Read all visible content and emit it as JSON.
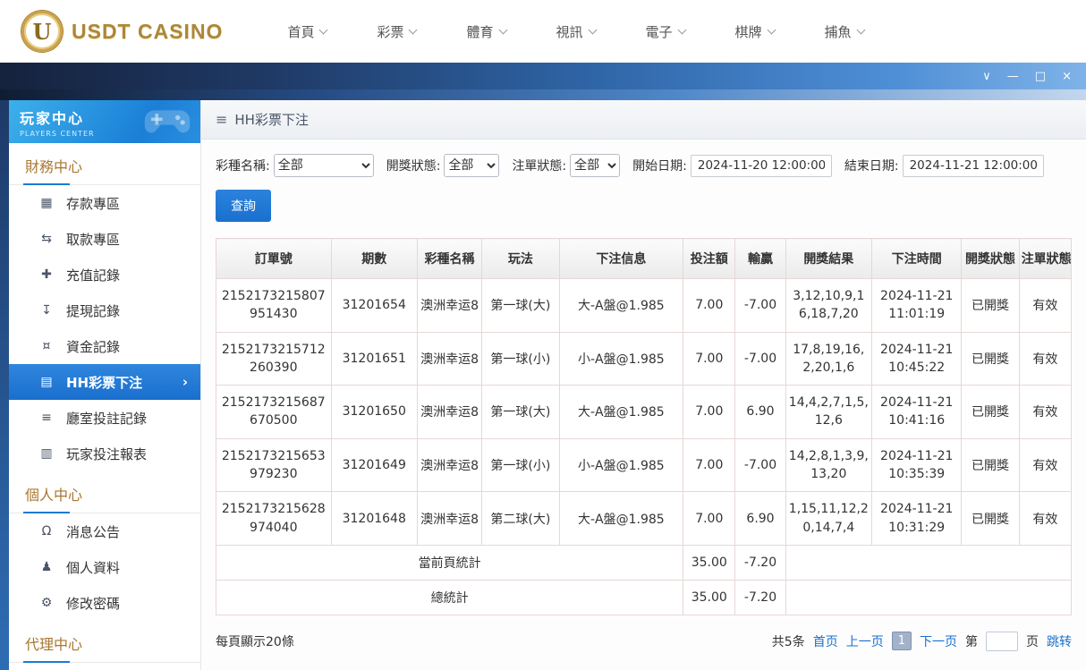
{
  "top_nav": {
    "brand": "USDT CASINO",
    "logo_letter": "U",
    "items": [
      {
        "label": "首頁"
      },
      {
        "label": "彩票"
      },
      {
        "label": "體育"
      },
      {
        "label": "視訊"
      },
      {
        "label": "電子"
      },
      {
        "label": "棋牌"
      },
      {
        "label": "捕魚"
      }
    ]
  },
  "window": {
    "controls": {
      "collapse": "∨",
      "minimize": "—",
      "maximize": "□",
      "close": "×"
    }
  },
  "sidebar": {
    "title": "玩家中心",
    "subtitle": "PLAYERS CENTER",
    "active_arrow": "›",
    "sections": [
      {
        "title": "財務中心",
        "items": [
          {
            "label": "存款專區",
            "icon": "▦"
          },
          {
            "label": "取款專區",
            "icon": "⇆"
          },
          {
            "label": "充值記錄",
            "icon": "✚"
          },
          {
            "label": "提現記錄",
            "icon": "↧"
          },
          {
            "label": "資金記錄",
            "icon": "¤"
          },
          {
            "label": "HH彩票下注",
            "icon": "▤"
          },
          {
            "label": "廳室投註記錄",
            "icon": "≡"
          },
          {
            "label": "玩家投注報表",
            "icon": "▥"
          }
        ]
      },
      {
        "title": "個人中心",
        "items": [
          {
            "label": "消息公告",
            "icon": "Ω"
          },
          {
            "label": "個人資料",
            "icon": "♟"
          },
          {
            "label": "修改密碼",
            "icon": "⚙"
          }
        ]
      },
      {
        "title": "代理中心",
        "items": []
      }
    ]
  },
  "main": {
    "breadcrumb": "HH彩票下注",
    "menu_glyph": "≡",
    "filters": {
      "lottery_label": "彩種名稱:",
      "lottery_value": "全部",
      "draw_status_label": "開獎狀態:",
      "draw_status_value": "全部",
      "order_status_label": "注單狀態:",
      "order_status_value": "全部",
      "start_label": "開始日期:",
      "start_value": "2024-11-20 12:00:00",
      "end_label": "結束日期:",
      "end_value": "2024-11-21 12:00:00",
      "search_button": "查詢"
    },
    "table": {
      "headers": [
        "訂單號",
        "期數",
        "彩種名稱",
        "玩法",
        "下注信息",
        "投注額",
        "輸贏",
        "開獎結果",
        "下注時間",
        "開獎狀態",
        "注單狀態"
      ],
      "rows": [
        {
          "order": "2152173215807951430",
          "period": "31201654",
          "lottery": "澳洲幸运8",
          "play": "第一球(大)",
          "info": "大-A盤@1.985",
          "amount": "7.00",
          "winloss": "-7.00",
          "result": "3,12,10,9,16,18,7,20",
          "time": "2024-11-21 11:01:19",
          "draw_status": "已開獎",
          "order_status": "有效"
        },
        {
          "order": "2152173215712260390",
          "period": "31201651",
          "lottery": "澳洲幸运8",
          "play": "第一球(小)",
          "info": "小-A盤@1.985",
          "amount": "7.00",
          "winloss": "-7.00",
          "result": "17,8,19,16,2,20,1,6",
          "time": "2024-11-21 10:45:22",
          "draw_status": "已開獎",
          "order_status": "有效"
        },
        {
          "order": "2152173215687670500",
          "period": "31201650",
          "lottery": "澳洲幸运8",
          "play": "第一球(大)",
          "info": "大-A盤@1.985",
          "amount": "7.00",
          "winloss": "6.90",
          "result": "14,4,2,7,1,5,12,6",
          "time": "2024-11-21 10:41:16",
          "draw_status": "已開獎",
          "order_status": "有效"
        },
        {
          "order": "2152173215653979230",
          "period": "31201649",
          "lottery": "澳洲幸运8",
          "play": "第一球(小)",
          "info": "小-A盤@1.985",
          "amount": "7.00",
          "winloss": "-7.00",
          "result": "14,2,8,1,3,9,13,20",
          "time": "2024-11-21 10:35:39",
          "draw_status": "已開獎",
          "order_status": "有效"
        },
        {
          "order": "2152173215628974040",
          "period": "31201648",
          "lottery": "澳洲幸运8",
          "play": "第二球(大)",
          "info": "大-A盤@1.985",
          "amount": "7.00",
          "winloss": "6.90",
          "result": "1,15,11,12,20,14,7,4",
          "time": "2024-11-21 10:31:29",
          "draw_status": "已開獎",
          "order_status": "有效"
        }
      ],
      "page_total": {
        "label": "當前頁統計",
        "bet": "35.00",
        "winloss": "-7.20"
      },
      "grand_total": {
        "label": "總統計",
        "bet": "35.00",
        "winloss": "-7.20"
      }
    },
    "pagination": {
      "page_size_text": "每頁顯示20條",
      "total_text": "共5条",
      "first": "首页",
      "prev": "上一页",
      "current": "1",
      "next": "下一页",
      "jump_prefix": "第",
      "jump_suffix": "页",
      "jump_button": "跳转"
    }
  }
}
